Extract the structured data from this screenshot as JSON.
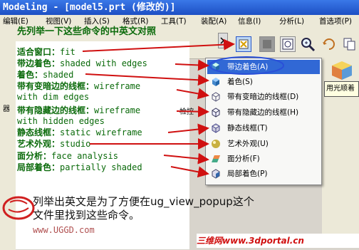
{
  "window": {
    "title": "Modeling - [model5.prt (修改的)]"
  },
  "menubar": [
    "编辑(E)",
    "视图(V)",
    "插入(S)",
    "格式(R)",
    "工具(T)",
    "装配(A)",
    "信息(I)",
    "分析(L)",
    "首选项(P)"
  ],
  "overlay": {
    "heading": "先列举一下这些命令的中英文对照",
    "pairs": [
      {
        "cn": "适合窗口：",
        "en": "fit"
      },
      {
        "cn": "带边着色：",
        "en": "shaded with edges"
      },
      {
        "cn": "着色：",
        "en": "shaded"
      },
      {
        "cn": "带有变暗边的线框：",
        "en": "wireframe"
      },
      {
        "cn": "",
        "en": "with dim edges"
      },
      {
        "cn": "带有隐藏边的线框：",
        "en": "wireframe"
      },
      {
        "cn": "",
        "en": "with hidden edges"
      },
      {
        "cn": "静态线框：",
        "en": "static wireframe"
      },
      {
        "cn": "艺术外观：",
        "en": "studio"
      },
      {
        "cn": "面分析：",
        "en": "face analysis"
      },
      {
        "cn": "局部着色：",
        "en": "partially shaded"
      }
    ],
    "note_line1": "列举出英文是为了方便在ug_view_popup这个",
    "note_line2": "文件里找到这些命令。",
    "watermark": "www.UGGD.com"
  },
  "side_labels": {
    "a": "器",
    "b": "检控"
  },
  "menu": {
    "items": [
      {
        "label": "带边着色(A)",
        "icon": "shaded-edges-cube-icon",
        "selected": true
      },
      {
        "label": "着色(S)",
        "icon": "shaded-cube-icon"
      },
      {
        "label": "带有变暗边的线框(D)",
        "icon": "dim-wireframe-cube-icon"
      },
      {
        "label": "带有隐藏边的线框(H)",
        "icon": "hidden-wireframe-cube-icon"
      },
      {
        "label": "静态线框(T)",
        "icon": "static-wireframe-cube-icon"
      },
      {
        "label": "艺术外观(U)",
        "icon": "studio-sphere-icon"
      },
      {
        "label": "面分析(F)",
        "icon": "face-analysis-icon"
      },
      {
        "label": "局部着色(P)",
        "icon": "partial-shade-cube-icon"
      }
    ]
  },
  "tooltip": "用光顺着",
  "site": "三维网www.3dportal.cn",
  "colors": {
    "annotation": "#0a6a0a",
    "arrow": "#d01010",
    "highlight": "#3168d5",
    "title": "#1d4fc4"
  }
}
